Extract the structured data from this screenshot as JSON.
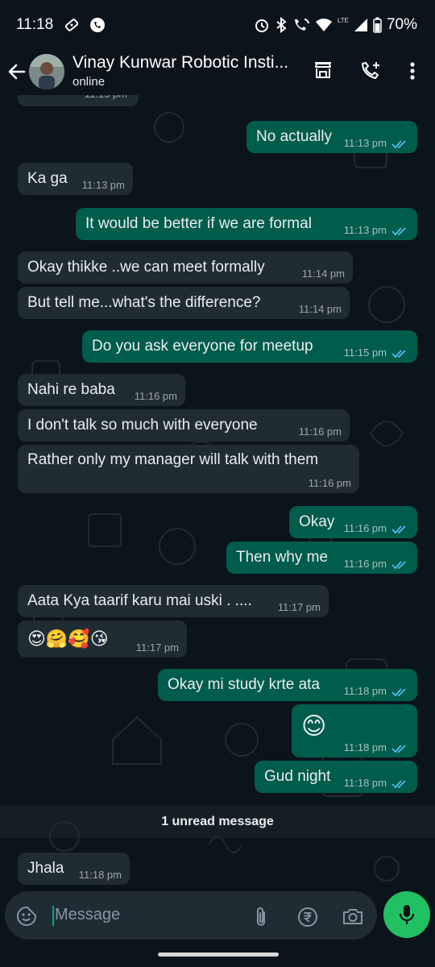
{
  "status_bar": {
    "time": "11:18",
    "network": "LTE",
    "battery": "70%"
  },
  "header": {
    "contact_name": "Vinay Kunwar Robotic Insti...",
    "status": "online",
    "icons": [
      "back-arrow-icon",
      "store-icon",
      "add-call-icon",
      "more-vert-icon"
    ]
  },
  "messages": [
    {
      "dir": "out",
      "text": "No actually",
      "time": "11:13 pm",
      "read": true
    },
    {
      "dir": "in",
      "text": "Ka ga",
      "time": "11:13 pm"
    },
    {
      "dir": "out",
      "text": "It would be better if we are formal",
      "time": "11:13 pm",
      "read": true
    },
    {
      "dir": "in",
      "text": "Okay thikke ..we can meet formally",
      "time": "11:14 pm"
    },
    {
      "dir": "in",
      "text": "But tell me...what's the difference?",
      "time": "11:14 pm"
    },
    {
      "dir": "out",
      "text": "Do you ask everyone  for meetup",
      "time": "11:15 pm",
      "read": true
    },
    {
      "dir": "in",
      "text": "Nahi re baba",
      "time": "11:16 pm"
    },
    {
      "dir": "in",
      "text": "I don't talk so much with everyone",
      "time": "11:16 pm"
    },
    {
      "dir": "in",
      "text": "Rather only my manager will talk with them",
      "time": "11:16 pm"
    },
    {
      "dir": "out",
      "text": "Okay",
      "time": "11:16 pm",
      "read": true
    },
    {
      "dir": "out",
      "text": "Then why me",
      "time": "11:16 pm",
      "read": true
    },
    {
      "dir": "in",
      "text": "Aata Kya taarif karu mai uski . ....",
      "time": "11:17 pm"
    },
    {
      "dir": "in",
      "text": "😍🤗🥰😘",
      "time": "11:17 pm"
    },
    {
      "dir": "out",
      "text": "Okay mi study krte ata",
      "time": "11:18 pm",
      "read": true
    },
    {
      "dir": "out",
      "text": "😊",
      "time": "11:18 pm",
      "read": true
    },
    {
      "dir": "out",
      "text": "Gud night",
      "time": "11:18 pm",
      "read": true
    },
    {
      "dir": "in",
      "text": "Jhala",
      "time": "11:18 pm"
    }
  ],
  "unread_label": "1 unread message",
  "input": {
    "placeholder": "Message"
  },
  "colors": {
    "incoming": "#202c33",
    "outgoing": "#005c4b",
    "accent": "#21c063",
    "read_tick": "#53bdeb"
  }
}
